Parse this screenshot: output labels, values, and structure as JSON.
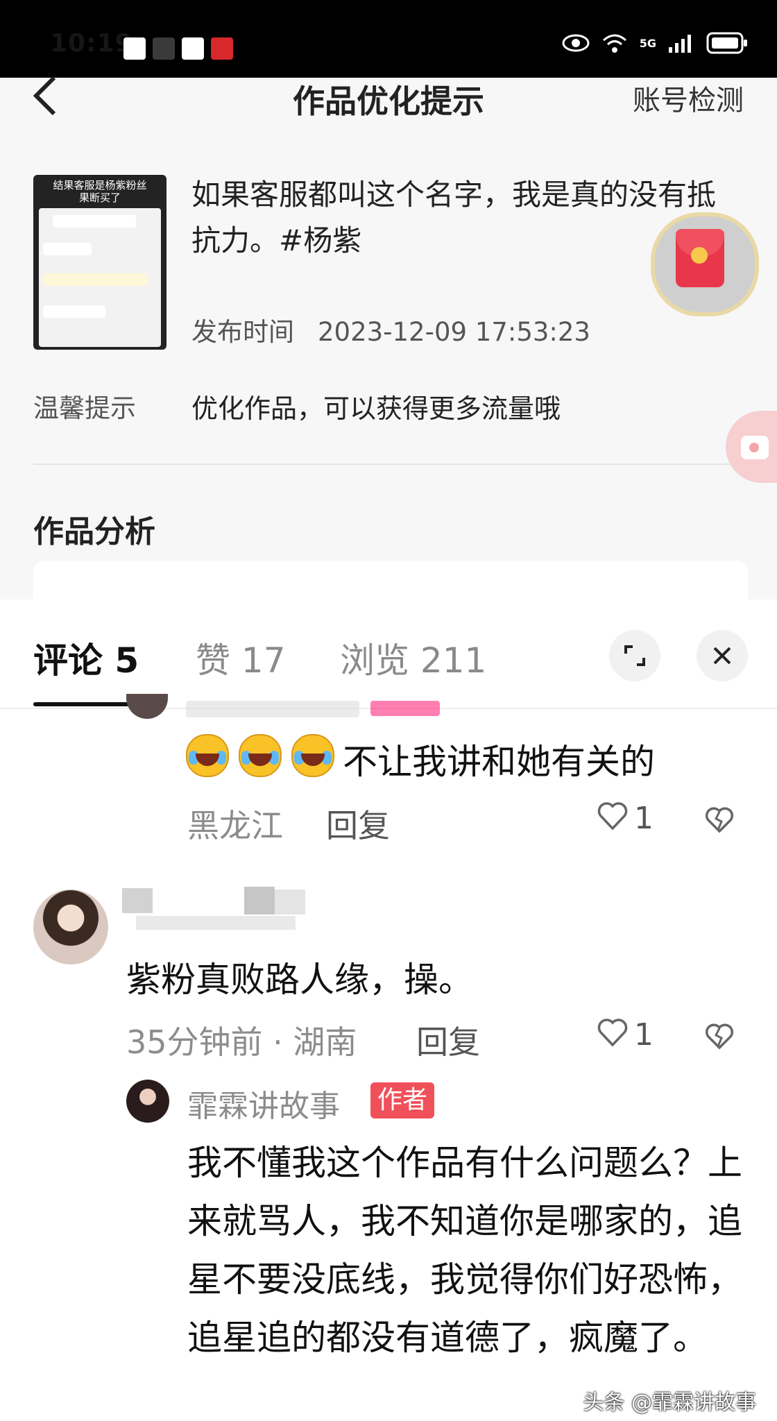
{
  "status_bar": {
    "time": "10:19",
    "app_icons": [
      "video-icon",
      "soul-icon",
      "sina-icon",
      "heart-app-icon"
    ],
    "right_icons": [
      "eye-icon",
      "wifi-icon",
      "5g-signal-icon",
      "battery-icon"
    ],
    "network": "5G"
  },
  "header": {
    "back_icon": "chevron-left-icon",
    "title": "作品优化提示",
    "right_action": "账号检测"
  },
  "work": {
    "thumbnail_caption": "结果客服是杨紫粉丝\n果断买了",
    "description": "如果客服都叫这个名字，我是真的没有抵抗力。#杨紫",
    "publish_label": "发布时间",
    "publish_time": "2023-12-09 17:53:23",
    "tip_label": "温馨提示",
    "tip_text": "优化作品，可以获得更多流量哦",
    "analysis_title": "作品分析"
  },
  "comments_sheet": {
    "tabs": [
      {
        "label": "评论 5",
        "active": true
      },
      {
        "label": "赞 17",
        "active": false
      },
      {
        "label": "浏览 211",
        "active": false
      }
    ],
    "expand_icon": "expand-icon",
    "close_icon": "close-icon",
    "comments": [
      {
        "emoji": "laughing-crying-emoji",
        "text": "不让我讲和她有关的",
        "location": "黑龙江",
        "reply_label": "回复",
        "likes": "1"
      },
      {
        "text": "紫粉真败路人缘，操。",
        "time_location": "35分钟前 · 湖南",
        "reply_label": "回复",
        "likes": "1"
      },
      {
        "author": "霏霖讲故事",
        "badge": "作者",
        "text": "我不懂我这个作品有什么问题么？上来就骂人，我不知道你是哪家的，追星不要没底线，我觉得你们好恐怖，追星追的都没有道德了，疯魔了。"
      }
    ]
  },
  "watermark": "头条 @霏霖讲故事",
  "colors": {
    "accent_red": "#f0505a",
    "text_primary": "#111111",
    "text_secondary": "#8c8c8c"
  }
}
